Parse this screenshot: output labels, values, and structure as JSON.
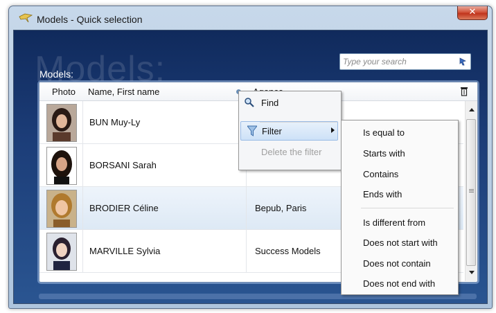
{
  "window": {
    "title": "Models - Quick selection",
    "close_glyph": "✕"
  },
  "header": {
    "watermark": "Models:",
    "models_label": "Models:"
  },
  "search": {
    "placeholder": "Type your search",
    "icon": "search-go-icon"
  },
  "table": {
    "columns": [
      "Photo",
      "Name, First name",
      "Agence"
    ],
    "rows": [
      {
        "name": "BUN Muy-Ly",
        "agency": ""
      },
      {
        "name": "BORSANI Sarah",
        "agency": ""
      },
      {
        "name": "BRODIER Céline",
        "agency": "Bepub, Paris",
        "selected": true
      },
      {
        "name": "MARVILLE Sylvia",
        "agency": "Success Models"
      }
    ]
  },
  "context_menu": {
    "items": [
      {
        "label": "Find",
        "icon": "magnifier-icon"
      },
      {
        "label": "Filter",
        "icon": "funnel-icon",
        "has_submenu": true,
        "highlighted": true
      },
      {
        "label": "Delete the filter",
        "disabled": true
      }
    ]
  },
  "filter_submenu": {
    "items": [
      "Is equal to",
      "Starts with",
      "Contains",
      "Ends with",
      "Is different from",
      "Does not start with",
      "Does not contain",
      "Does not end with"
    ]
  },
  "colors": {
    "background_top": "#102a5c",
    "background_bottom": "#2a5591",
    "selection": "#dde9f5",
    "menu_highlight": "#cde1f7"
  }
}
